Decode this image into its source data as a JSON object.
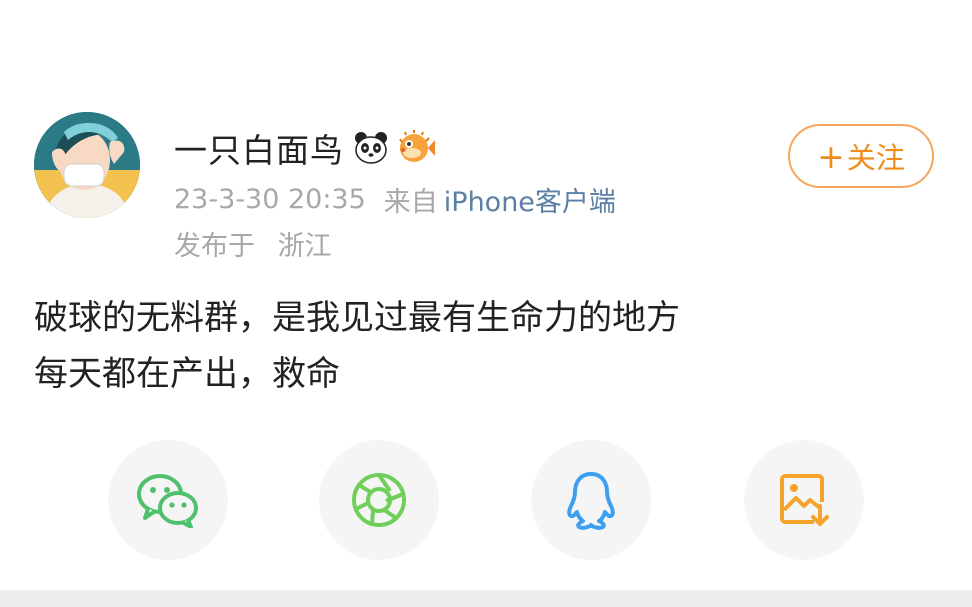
{
  "post": {
    "author": {
      "name": "一只白面鸟",
      "badges": [
        "panda-emoji",
        "pufferfish-emoji"
      ]
    },
    "timestamp": "23-3-30 20:35",
    "source_prefix": "来自",
    "source_client": "iPhone客户端",
    "location_prefix": "发布于",
    "location": "浙江",
    "content_lines": [
      "破球的无料群，是我见过最有生命力的地方",
      "每天都在产出，救命"
    ]
  },
  "follow_button": {
    "plus": "+",
    "label": "关注"
  },
  "share_actions": [
    {
      "icon": "wechat-icon",
      "color": "#4fc06b"
    },
    {
      "icon": "moments-icon",
      "color": "#6fcf5a"
    },
    {
      "icon": "qq-icon",
      "color": "#3d9ff0"
    },
    {
      "icon": "save-image-icon",
      "color": "#f5a32a"
    }
  ],
  "colors": {
    "accent": "#f08c1a",
    "follow_border": "#f5a55c",
    "meta_text": "#a8a8a8",
    "client_link": "#5b7fa5"
  }
}
